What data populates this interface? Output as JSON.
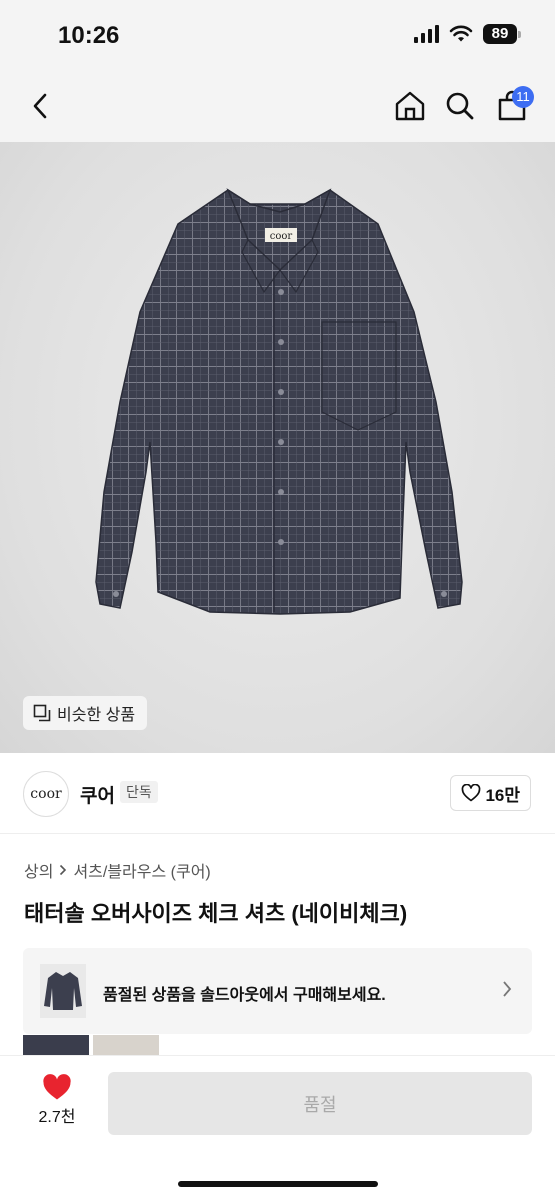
{
  "status": {
    "time": "10:26",
    "battery": "89"
  },
  "nav": {
    "cart_count": "11"
  },
  "hero": {
    "similar_label": "비슷한 상품",
    "shirt_tag": "coor"
  },
  "seller": {
    "logo_text": "coor",
    "name": "쿠어",
    "tag": "단독",
    "likes": "16만"
  },
  "breadcrumb": {
    "category": "상의",
    "subcategory": "셔츠/블라우스 (쿠어)"
  },
  "product": {
    "title": "태터솔 오버사이즈 체크 셔츠 (네이비체크)"
  },
  "banner": {
    "text": "품절된 상품을 솔드아웃에서 구매해보세요."
  },
  "bottom": {
    "wish_count": "2.7천",
    "buy_label": "품절"
  },
  "colors": {
    "accent": "#3d6df2",
    "heart": "#e8242f",
    "shirt": "#3c3f4e"
  }
}
